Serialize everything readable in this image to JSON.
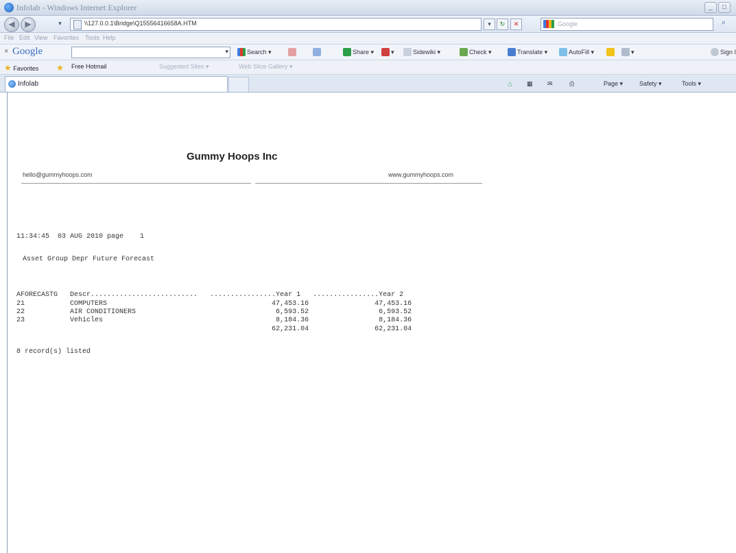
{
  "window": {
    "title": "Infolab - Windows Internet Explorer",
    "minimize": "_",
    "maximize": "□"
  },
  "address_bar": {
    "url": "\\\\127.0.0.1\\Bridge\\Q15556416658A.HTM",
    "search_placeholder": "Google",
    "search_go": "⌕"
  },
  "menu": [
    "File",
    "Edit",
    "View",
    "Favorites",
    "Tools",
    "Help"
  ],
  "google_toolbar": {
    "close": "×",
    "logo": "Google",
    "items": [
      "Search ▾",
      "Share ▾",
      "Sidewiki ▾",
      "Check ▾",
      "Translate ▾",
      "AutoFill ▾",
      "Sign In"
    ]
  },
  "favorites_bar": {
    "favorites": "Favorites",
    "free_hotmail": "Free Hotmail",
    "suggested_sites": "Suggested Sites ▾",
    "web_slice_gallery": "Web Slice Gallery ▾"
  },
  "tabs": [
    {
      "label": "Infolab"
    }
  ],
  "command_bar": [
    "Page ▾",
    "Safety ▾",
    "Tools ▾"
  ],
  "report": {
    "company": "Gummy Hoops Inc",
    "email": "hello@gummyhoops.com",
    "website": "www.gummyhoops.com",
    "timestamp_line": "11:34:45  03 AUG 2010 page    1",
    "report_title": "Asset Group Depr Future Forecast",
    "header_line": "AFORECASTG   Descr..........................   ................Year 1   ................Year 2",
    "rows": [
      "21           COMPUTERS                                        47,453.16                47,453.16",
      "22           AIR CONDITIONERS                                  6,593.52                 6,593.52",
      "23           Vehicles                                          8,184.36                 8,184.36",
      "                                                              62,231.04                62,231.04"
    ],
    "footer": "8 record(s) listed"
  }
}
